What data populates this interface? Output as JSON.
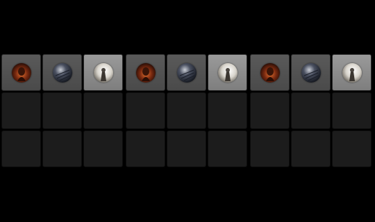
{
  "banks": [
    {
      "thumbs": [
        "fire-portrait",
        "metal-sphere",
        "bright-figure"
      ]
    },
    {
      "thumbs": [
        "fire-portrait",
        "metal-sphere",
        "bright-figure"
      ]
    },
    {
      "thumbs": [
        "fire-portrait",
        "metal-sphere",
        "bright-figure"
      ]
    }
  ],
  "colors": {
    "background": "#000000",
    "pad_empty": "#1c1c1c",
    "pad_filled": "#555555",
    "pad_highlight": "#8c8c8c"
  }
}
